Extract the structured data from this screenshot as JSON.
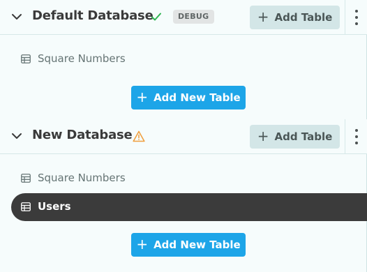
{
  "databases": [
    {
      "title": "Default Database",
      "status_icon": "check-icon",
      "status_color": "#2fb552",
      "badge": "DEBUG",
      "add_table_label": "Add Table",
      "tables": [
        {
          "label": "Square Numbers",
          "active": false
        }
      ],
      "add_new_table_label": "Add New Table"
    },
    {
      "title": "New Database",
      "status_icon": "warning-icon",
      "status_color": "#f0a040",
      "add_table_label": "Add Table",
      "tables": [
        {
          "label": "Square Numbers",
          "active": false
        },
        {
          "label": "Users",
          "active": true
        }
      ],
      "add_new_table_label": "Add New Table"
    }
  ],
  "colors": {
    "primary_button": "#1da5e8",
    "secondary_button": "#d3e6e7",
    "active_item": "#3b3b3b",
    "background": "#f6fcfc"
  }
}
